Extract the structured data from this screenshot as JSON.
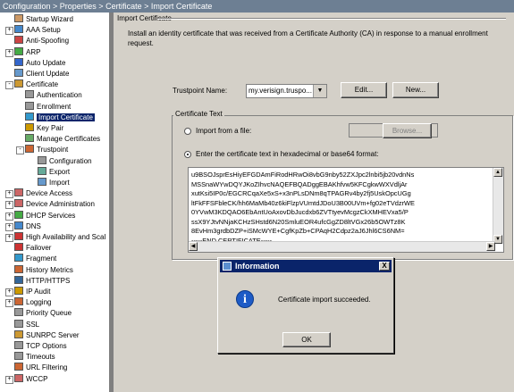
{
  "window": {
    "breadcrumb": "Configuration > Properties > Certificate > Import Certificate"
  },
  "tree": {
    "items": [
      {
        "label": "Startup Wizard",
        "icon": "wizard-icon"
      },
      {
        "label": "AAA Setup",
        "icon": "aaa-icon",
        "expander": "+"
      },
      {
        "label": "Anti-Spoofing",
        "icon": "anti-spoofing-icon"
      },
      {
        "label": "ARP",
        "icon": "arp-icon",
        "expander": "+"
      },
      {
        "label": "Auto Update",
        "icon": "auto-update-icon"
      },
      {
        "label": "Client Update",
        "icon": "client-update-icon"
      },
      {
        "label": "Certificate",
        "icon": "certificate-icon",
        "expander": "-"
      },
      {
        "label": "Authentication",
        "icon": "authentication-icon"
      },
      {
        "label": "Enrollment",
        "icon": "enrollment-icon"
      },
      {
        "label": "Import Certificate",
        "icon": "import-certificate-icon",
        "selected": true
      },
      {
        "label": "Key Pair",
        "icon": "key-pair-icon"
      },
      {
        "label": "Manage Certificates",
        "icon": "manage-certificates-icon"
      },
      {
        "label": "Trustpoint",
        "icon": "trustpoint-icon",
        "expander": "-"
      },
      {
        "label": "Configuration",
        "icon": "configuration-icon"
      },
      {
        "label": "Export",
        "icon": "export-icon"
      },
      {
        "label": "Import",
        "icon": "import-icon"
      },
      {
        "label": "Device Access",
        "icon": "device-access-icon",
        "expander": "+"
      },
      {
        "label": "Device Administration",
        "icon": "device-administration-icon",
        "expander": "+"
      },
      {
        "label": "DHCP Services",
        "icon": "dhcp-services-icon",
        "expander": "+"
      },
      {
        "label": "DNS",
        "icon": "dns-icon",
        "expander": "+"
      },
      {
        "label": "High Availability and Scal",
        "icon": "high-availability-icon",
        "expander": "+"
      },
      {
        "label": "Failover",
        "icon": "failover-icon"
      },
      {
        "label": "Fragment",
        "icon": "fragment-icon"
      },
      {
        "label": "History Metrics",
        "icon": "history-metrics-icon"
      },
      {
        "label": "HTTP/HTTPS",
        "icon": "http-icon"
      },
      {
        "label": "IP Audit",
        "icon": "ip-audit-icon",
        "expander": "+"
      },
      {
        "label": "Logging",
        "icon": "logging-icon",
        "expander": "+"
      },
      {
        "label": "Priority Queue",
        "icon": "priority-queue-icon"
      },
      {
        "label": "SSL",
        "icon": "ssl-icon"
      },
      {
        "label": "SUNRPC Server",
        "icon": "sunrpc-icon"
      },
      {
        "label": "TCP Options",
        "icon": "tcp-options-icon"
      },
      {
        "label": "Timeouts",
        "icon": "timeouts-icon"
      },
      {
        "label": "URL Filtering",
        "icon": "url-filtering-icon"
      },
      {
        "label": "WCCP",
        "icon": "wccp-icon",
        "expander": "+"
      }
    ]
  },
  "main": {
    "section_title": "Import Certificate",
    "description": "Install an identity certificate that was received from a Certificate Authority (CA) in response to a manual enrollment request.",
    "trustpoint_label": "Trustpoint Name:",
    "trustpoint_value": "my.verisign.truspo...",
    "edit_label": "Edit...",
    "new_label": "New...",
    "cert_group_title": "Certificate Text",
    "import_file_label": "Import from a file:",
    "browse_label": "Browse...",
    "enter_text_label": "Enter the certificate text in hexadecimal or base64 format:",
    "cert_lines": [
      "u9BSOJsprEsHiyEFGDAmFiRodHRwOi8vbG9nby52ZXJpc2lnbi5jb20vdnNs",
      "MSSnaWYwDQYJKoZIhvcNAQEFBQADggEBAKhfvw5KFCgkwWXVdljAr",
      "xutKsi5IP0c/EGCRCqaXe5xS+x3nPLsDNm8qTPAGRv4by2fj5UskOpcUGg",
      "ltFkFFSFbleCK/hh6MaMb40z6kiFlzpVUmtdJDoU3B00UVm+fg02eTVdzrWE",
      "0YVwM3KDQAO6EbAntUoAxovDbJucdxb6ZVTtyevMcgzCkXMHEVxa5/P",
      "ssX9YJtvNNjaKCHzSHstd6N20SmluEOR4ufcGgZD8ltVGx26b5OWTz8K",
      "8EvHm3grdbDZP+iSMcWYE+CgfKpZb+CPAqH2Cdpz2aJ6Jhl6CS6NM=",
      "-----END CERTIFICATE-----"
    ]
  },
  "dialog": {
    "title": "Information",
    "message": "Certificate import succeeded.",
    "ok_label": "OK",
    "close_label": "X"
  }
}
